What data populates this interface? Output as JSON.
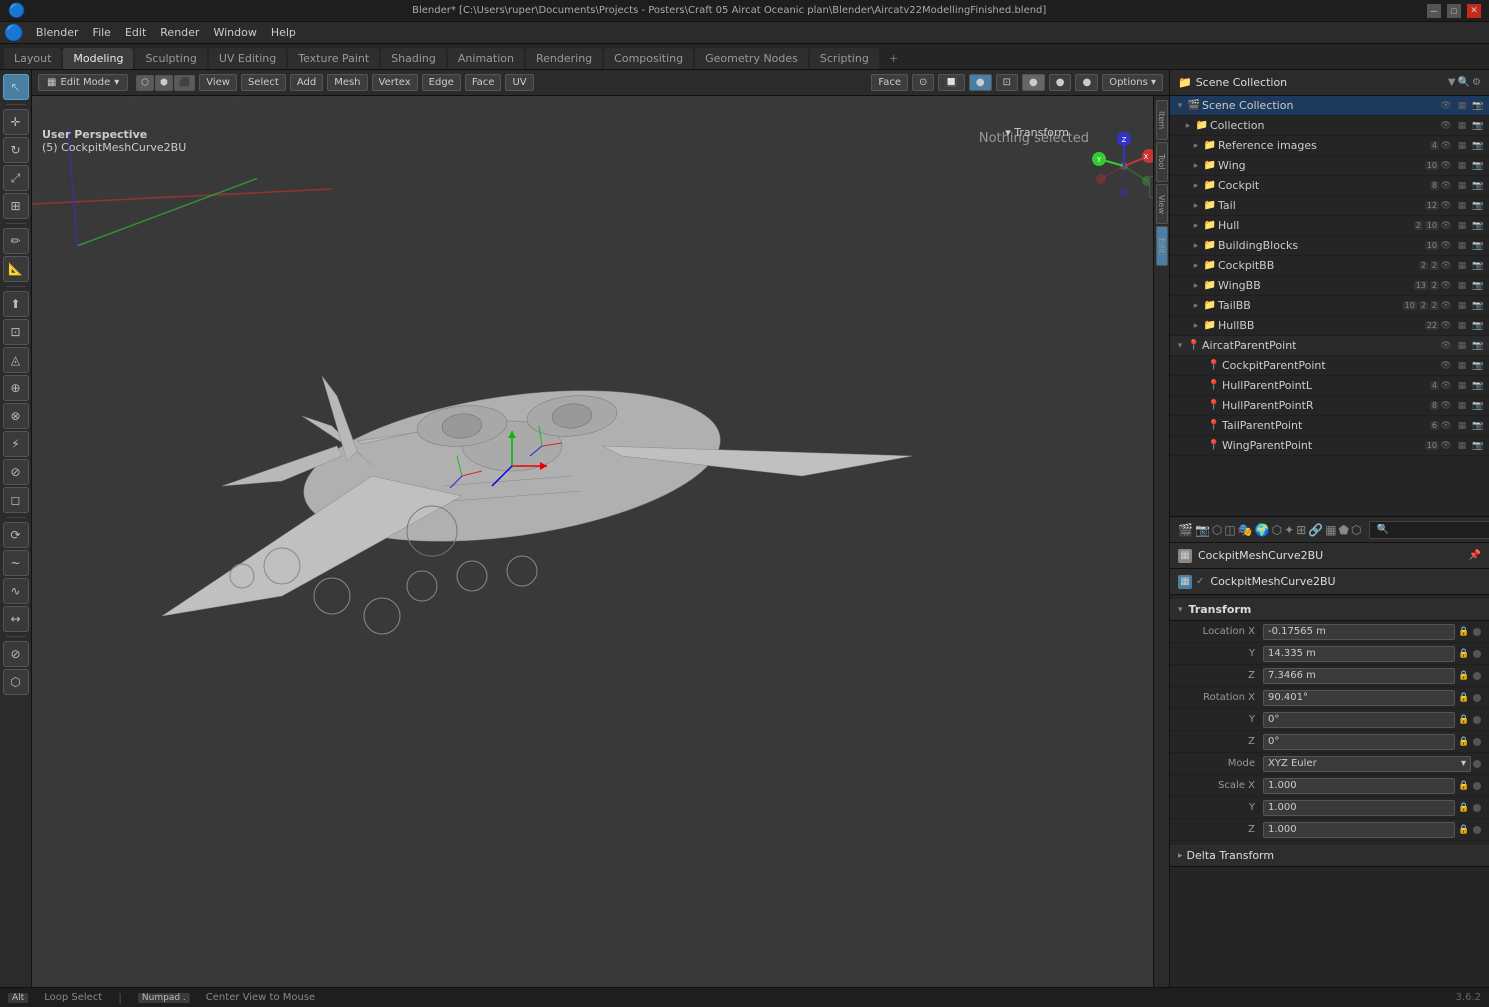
{
  "titlebar": {
    "title": "Blender* [C:\\Users\\ruper\\Documents\\Projects - Posters\\Craft 05 Aircat Oceanic plan\\Blender\\Aircatv22ModellingFinished.blend]",
    "min": "─",
    "max": "□",
    "close": "✕"
  },
  "menubar": {
    "items": [
      "Blender",
      "File",
      "Edit",
      "Render",
      "Window",
      "Help"
    ]
  },
  "workspace_tabs": {
    "tabs": [
      "Layout",
      "Modeling",
      "Sculpting",
      "UV Editing",
      "Texture Paint",
      "Shading",
      "Animation",
      "Rendering",
      "Compositing",
      "Geometry Nodes",
      "Scripting"
    ],
    "active": "Modeling",
    "plus": "+"
  },
  "viewport_header": {
    "mode": "Edit Mode",
    "view_options": [
      "View",
      "Select",
      "Add",
      "Mesh",
      "Vertex",
      "Edge",
      "Face",
      "UV"
    ],
    "face_select": "Face",
    "axis_labels": [
      "X",
      "Y",
      "Z"
    ],
    "options": "Options ▾"
  },
  "viewport": {
    "perspective_label": "User Perspective",
    "object_name": "(5) CockpitMeshCurve2BU",
    "nothing_selected": "Nothing selected",
    "transform_label": "Transform"
  },
  "outliner": {
    "title": "Scene Collection",
    "search_placeholder": "",
    "items": [
      {
        "indent": 0,
        "expand": "▾",
        "icon": "📁",
        "name": "Collection",
        "badges": [],
        "level": 0
      },
      {
        "indent": 1,
        "expand": "▸",
        "icon": "📁",
        "name": "Reference images",
        "badges": [
          "4"
        ],
        "level": 1
      },
      {
        "indent": 1,
        "expand": "▸",
        "icon": "📁",
        "name": "Wing",
        "badges": [
          "10"
        ],
        "level": 1
      },
      {
        "indent": 1,
        "expand": "▸",
        "icon": "📁",
        "name": "Cockpit",
        "badges": [
          "8"
        ],
        "level": 1
      },
      {
        "indent": 1,
        "expand": "▸",
        "icon": "📁",
        "name": "Tail",
        "badges": [
          "12"
        ],
        "level": 1
      },
      {
        "indent": 1,
        "expand": "▸",
        "icon": "📁",
        "name": "Hull",
        "badges": [
          "2",
          "10"
        ],
        "level": 1
      },
      {
        "indent": 1,
        "expand": "▸",
        "icon": "📁",
        "name": "BuildingBlocks",
        "badges": [
          "10"
        ],
        "level": 1
      },
      {
        "indent": 1,
        "expand": "▸",
        "icon": "📁",
        "name": "CockpitBB",
        "badges": [
          "2",
          "2"
        ],
        "level": 1
      },
      {
        "indent": 1,
        "expand": "▸",
        "icon": "📁",
        "name": "WingBB",
        "badges": [
          "13",
          "2"
        ],
        "level": 1
      },
      {
        "indent": 1,
        "expand": "▸",
        "icon": "📁",
        "name": "TailBB",
        "badges": [
          "10",
          "2",
          "2"
        ],
        "level": 1
      },
      {
        "indent": 1,
        "expand": "▸",
        "icon": "📁",
        "name": "HullBB",
        "badges": [
          "22"
        ],
        "level": 1
      },
      {
        "indent": 0,
        "expand": "▾",
        "icon": "📍",
        "name": "AircatParentPoint",
        "badges": [],
        "level": 0
      },
      {
        "indent": 1,
        "expand": " ",
        "icon": "📍",
        "name": "CockpitParentPoint",
        "badges": [],
        "level": 1
      },
      {
        "indent": 1,
        "expand": " ",
        "icon": "📍",
        "name": "HullParentPointL",
        "badges": [
          "4"
        ],
        "level": 1
      },
      {
        "indent": 1,
        "expand": " ",
        "icon": "📍",
        "name": "HullParentPointR",
        "badges": [
          "8"
        ],
        "level": 1
      },
      {
        "indent": 1,
        "expand": " ",
        "icon": "📍",
        "name": "TailParentPoint",
        "badges": [
          "6"
        ],
        "level": 1
      },
      {
        "indent": 1,
        "expand": " ",
        "icon": "📍",
        "name": "WingParentPoint",
        "badges": [
          "10"
        ],
        "level": 1
      }
    ]
  },
  "properties": {
    "search_placeholder": "Search...",
    "object_name": "CockpitMeshCurve2BU",
    "data_name": "CockpitMeshCurve2BU",
    "pin_icon": "📌",
    "transform_section": "Transform",
    "location": {
      "label": "Location X",
      "x": "-0.17565 m",
      "y": "14.335 m",
      "z": "7.3466 m"
    },
    "rotation": {
      "label": "Rotation X",
      "x": "90.401°",
      "y": "0°",
      "z": "0°"
    },
    "mode": {
      "label": "Mode",
      "value": "XYZ Euler"
    },
    "scale": {
      "label": "Scale X",
      "x": "1.000",
      "y": "1.000",
      "z": "1.000"
    },
    "delta_transform": "Delta Transform"
  },
  "prop_tabs": [
    "scene",
    "render",
    "output",
    "view_layer",
    "scene2",
    "world",
    "object",
    "particles",
    "physics",
    "constraints",
    "data",
    "material",
    "shader"
  ],
  "statusbar": {
    "loop_select": "Loop Select",
    "center_view": "Center View to Mouse",
    "version": "3.6.2"
  },
  "colors": {
    "accent_blue": "#4a7fa5",
    "bg_dark": "#1e1e1e",
    "bg_mid": "#252525",
    "bg_panel": "#2b2b2b",
    "active_orange": "#e87d0d",
    "grid_color": "#333333"
  }
}
